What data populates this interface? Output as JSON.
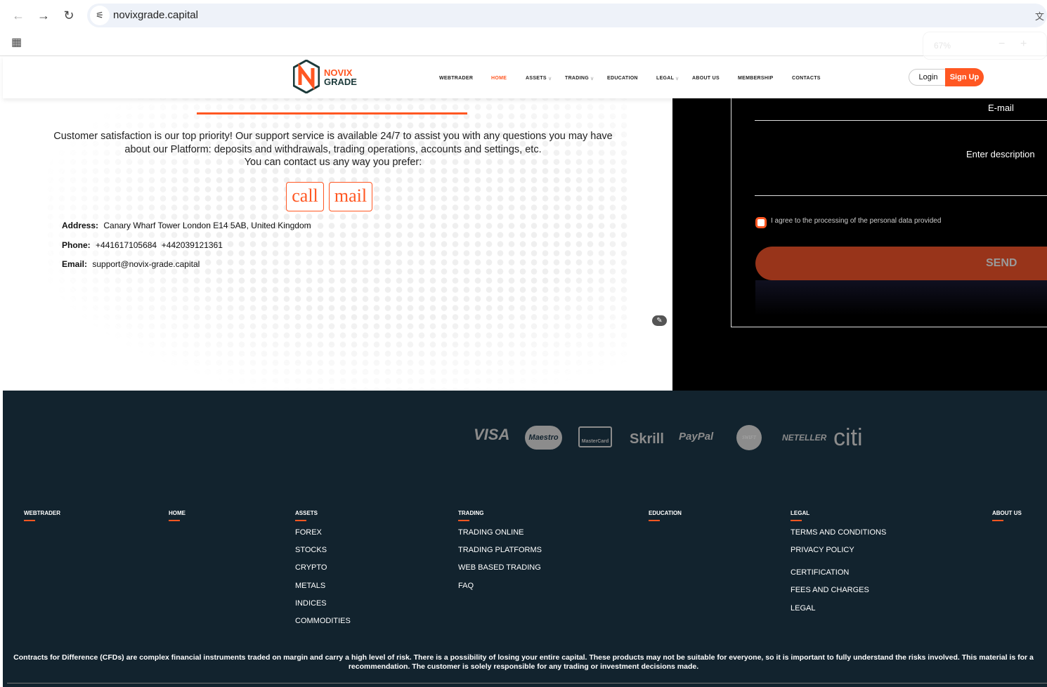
{
  "browser": {
    "url": "novixgrade.capital",
    "zoom": "67%",
    "zoom_minus": "−",
    "zoom_plus": "+"
  },
  "brand": {
    "line1": "NOVIX",
    "line2": "GRADE",
    "accent": "#ff5722"
  },
  "nav": [
    "WEBTRADER",
    "HOME",
    "ASSETS",
    "TRADING",
    "EDUCATION",
    "LEGAL",
    "ABOUT US",
    "MEMBERSHIP",
    "CONTACTS"
  ],
  "auth": {
    "login": "Login",
    "signup": "Sign Up"
  },
  "contact": {
    "intro": "Customer satisfaction is our top priority! Our support service is available 24/7 to assist you with any questions you may have about our Platform: deposits and withdrawals, trading operations, accounts and settings, etc.",
    "intro2": "You can contact us any way you prefer:",
    "call": "call",
    "mail": "mail",
    "address_label": "Address:",
    "address": "Canary Wharf Tower London E14 5AB, United Kingdom",
    "phone_label": "Phone:",
    "phone": "+441617105684  +442039121361",
    "email_label": "Email:",
    "email": "support@novix-grade.capital"
  },
  "form": {
    "email": "E-mail",
    "description": "Enter description",
    "agree": "I agree to the processing of the personal data provided",
    "send": "SEND"
  },
  "payments": [
    "VISA",
    "Maestro",
    "MasterCard",
    "Skrill",
    "PayPal",
    "SWIFT",
    "NETELLER",
    "citi"
  ],
  "footer": {
    "cols": [
      {
        "title": "WEBTRADER",
        "items": []
      },
      {
        "title": "HOME",
        "items": []
      },
      {
        "title": "ASSETS",
        "items": [
          "FOREX",
          "STOCKS",
          "CRYPTO",
          "METALS",
          "INDICES",
          "COMMODITIES"
        ]
      },
      {
        "title": "TRADING",
        "items": [
          "TRADING ONLINE",
          "TRADING PLATFORMS",
          "WEB BASED TRADING",
          "FAQ"
        ]
      },
      {
        "title": "EDUCATION",
        "items": []
      },
      {
        "title": "LEGAL",
        "items": [
          "TERMS AND CONDITIONS",
          "PRIVACY POLICY",
          "CERTIFICATION",
          "FEES AND CHARGES",
          "LEGAL"
        ]
      },
      {
        "title": "ABOUT US",
        "items": []
      }
    ],
    "disclaimer": "Contracts for Difference (CFDs) are complex financial instruments traded on margin and carry a high level of risk. There is a possibility of losing your entire capital. These products may not be suitable for everyone, so it is important to fully understand the risks involved. This material is for a recommendation. The customer is solely responsible for any trading or investment decisions made."
  }
}
